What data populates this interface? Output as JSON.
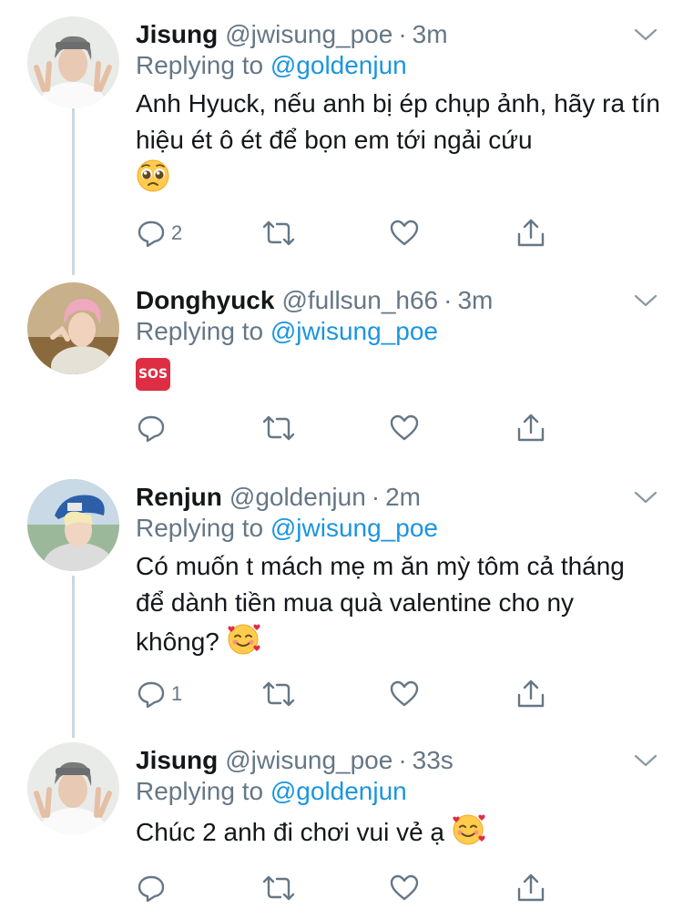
{
  "tweets": [
    {
      "name": "Jisung",
      "handle": "@jwisung_poe",
      "dot": "·",
      "time": "3m",
      "replying_prefix": "Replying to ",
      "replying_to": "@goldenjun",
      "body": "Anh Hyuck, nếu anh bị ép chụp ảnh, hãy ra tín hiệu ét ô ét để bọn em tới ngải cứu",
      "emoji": "pleading-face-emoji",
      "reply_count": "2"
    },
    {
      "name": "Donghyuck",
      "handle": "@fullsun_h66",
      "dot": "·",
      "time": "3m",
      "replying_prefix": "Replying to ",
      "replying_to": "@jwisung_poe",
      "body": "",
      "emoji": "sos-emoji",
      "emoji_text": "SOS",
      "reply_count": ""
    },
    {
      "name": "Renjun",
      "handle": "@goldenjun",
      "dot": "·",
      "time": "2m",
      "replying_prefix": "Replying to ",
      "replying_to": "@jwisung_poe",
      "body": "Có muốn t mách mẹ m ăn mỳ tôm cả tháng để dành tiền mua quà valentine cho ny không?",
      "emoji": "smiling-face-with-hearts-emoji",
      "reply_count": "1"
    },
    {
      "name": "Jisung",
      "handle": "@jwisung_poe",
      "dot": "·",
      "time": "33s",
      "replying_prefix": "Replying to ",
      "replying_to": "@goldenjun",
      "body": "Chúc 2 anh đi chơi vui vẻ ạ",
      "emoji": "smiling-face-with-hearts-emoji",
      "reply_count": ""
    }
  ],
  "icons": {
    "reply": "reply-icon",
    "retweet": "retweet-icon",
    "like": "heart-icon",
    "share": "share-icon",
    "menu": "chevron-down-icon"
  },
  "colors": {
    "text": "#14171a",
    "secondary": "#657786",
    "mention": "#1b95e0",
    "thread_line": "#ccd6dd"
  }
}
